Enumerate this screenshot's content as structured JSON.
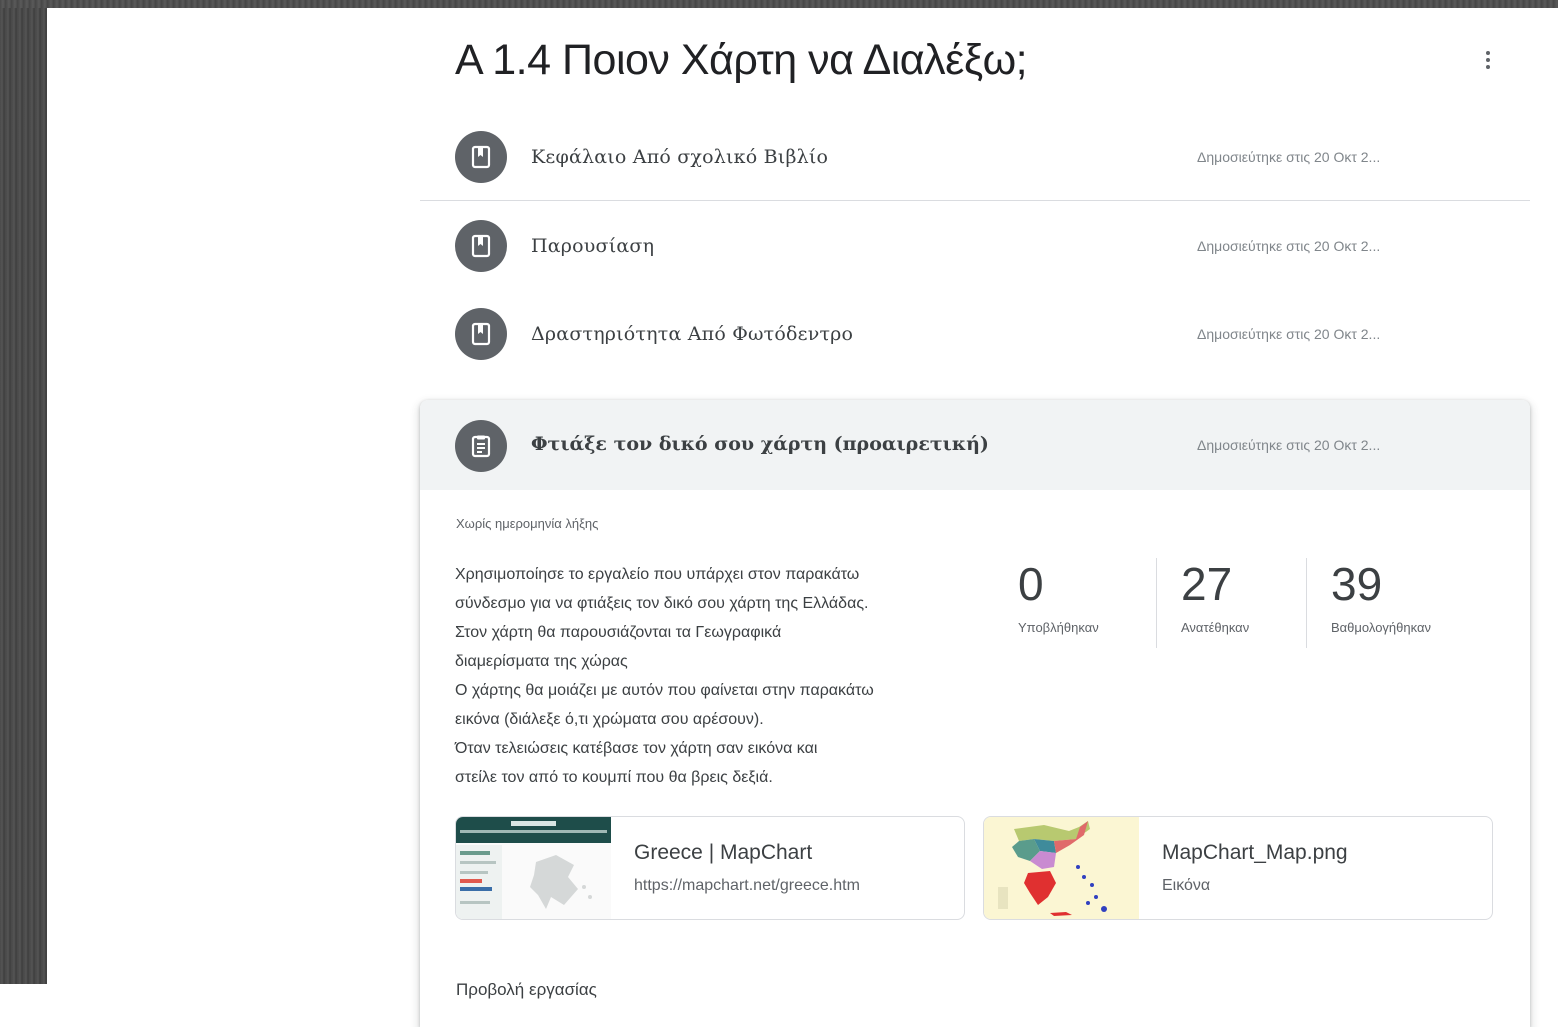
{
  "topic": {
    "title": "Α 1.4 Ποιον Χάρτη να Διαλέξω;"
  },
  "materials": [
    {
      "title": "Κεφάλαιο Από σχολικό Βιβλίο",
      "posted": "Δημοσιεύτηκε στις 20 Οκτ 2...",
      "icon": "material-book-icon"
    },
    {
      "title": "Παρουσίαση",
      "posted": "Δημοσιεύτηκε στις 20 Οκτ 2...",
      "icon": "material-book-icon"
    },
    {
      "title": "Δραστηριότητα Από Φωτόδεντρο",
      "posted": "Δημοσιεύτηκε στις 20 Οκτ 2...",
      "icon": "material-book-icon"
    }
  ],
  "assignment": {
    "title": "Φτιάξε τον δικό σου χάρτη (προαιρετική)",
    "posted": "Δημοσιεύτηκε στις 20 Οκτ 2...",
    "icon": "assignment-icon",
    "due": "Χωρίς ημερομηνία λήξης",
    "description": [
      "Χρησιμοποίησε το εργαλείο που υπάρχει στον παρακάτω",
      "σύνδεσμο για να φτιάξεις τον δικό σου χάρτη της Ελλάδας.",
      "Στον χάρτη θα παρουσιάζονται τα Γεωγραφικά",
      "διαμερίσματα της χώρας",
      "Ο χάρτης θα μοιάζει με αυτόν που φαίνεται στην παρακάτω",
      "εικόνα (διάλεξε ό,τι χρώματα σου αρέσουν).",
      "Όταν τελειώσεις κατέβασε τον χάρτη σαν εικόνα και",
      "στείλε τον από το κουμπί που θα βρεις δεξιά."
    ],
    "stats": {
      "handed_in": {
        "value": "0",
        "label": "Υποβλήθηκαν"
      },
      "assigned": {
        "value": "27",
        "label": "Ανατέθηκαν"
      },
      "graded": {
        "value": "39",
        "label": "Βαθμολογήθηκαν"
      }
    },
    "attachments": [
      {
        "title": "Greece | MapChart",
        "subtitle": "https://mapchart.net/greece.htm"
      },
      {
        "title": "MapChart_Map.png",
        "subtitle": "Εικόνα"
      }
    ],
    "view_link": "Προβολή εργασίας"
  },
  "colors": {
    "icon_circle": "#5f6368",
    "card_header": "#f1f3f4",
    "text_primary": "#3c4043",
    "text_secondary": "#80868b"
  }
}
